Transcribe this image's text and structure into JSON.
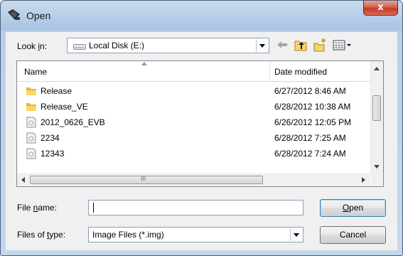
{
  "window": {
    "title": "Open",
    "close_glyph": "x"
  },
  "toolbar": {
    "look_in_label_pre": "Look ",
    "look_in_label_key": "i",
    "look_in_label_post": "n:",
    "look_in_value": "Local Disk (E:)",
    "icons": [
      "back-arrow-icon",
      "up-folder-icon",
      "new-folder-icon",
      "view-menu-icon"
    ]
  },
  "file_list": {
    "columns": {
      "name": "Name",
      "date": "Date modified"
    },
    "rows": [
      {
        "name": "Release",
        "date": "6/27/2012 8:46 AM",
        "type": "folder"
      },
      {
        "name": "Release_VE",
        "date": "6/28/2012 10:38 AM",
        "type": "folder"
      },
      {
        "name": "2012_0626_EVB",
        "date": "6/26/2012 12:05 PM",
        "type": "file"
      },
      {
        "name": "2234",
        "date": "6/28/2012 7:25 AM",
        "type": "file"
      },
      {
        "name": "12343",
        "date": "6/28/2012 7:24 AM",
        "type": "file"
      }
    ],
    "hscroll_grip": "III"
  },
  "footer": {
    "file_name_label_pre": "File ",
    "file_name_label_key": "n",
    "file_name_label_post": "ame:",
    "file_name_value": "",
    "file_type_label_pre": "Files of ",
    "file_type_label_key": "t",
    "file_type_label_post": "ype:",
    "file_type_value": "Image Files (*.img)",
    "open_pre": "",
    "open_key": "O",
    "open_post": "pen",
    "cancel_label": "Cancel"
  },
  "colors": {
    "close_button": "#c4392a",
    "title_bar": "#b8d0ea",
    "folder": "#e8b730"
  }
}
